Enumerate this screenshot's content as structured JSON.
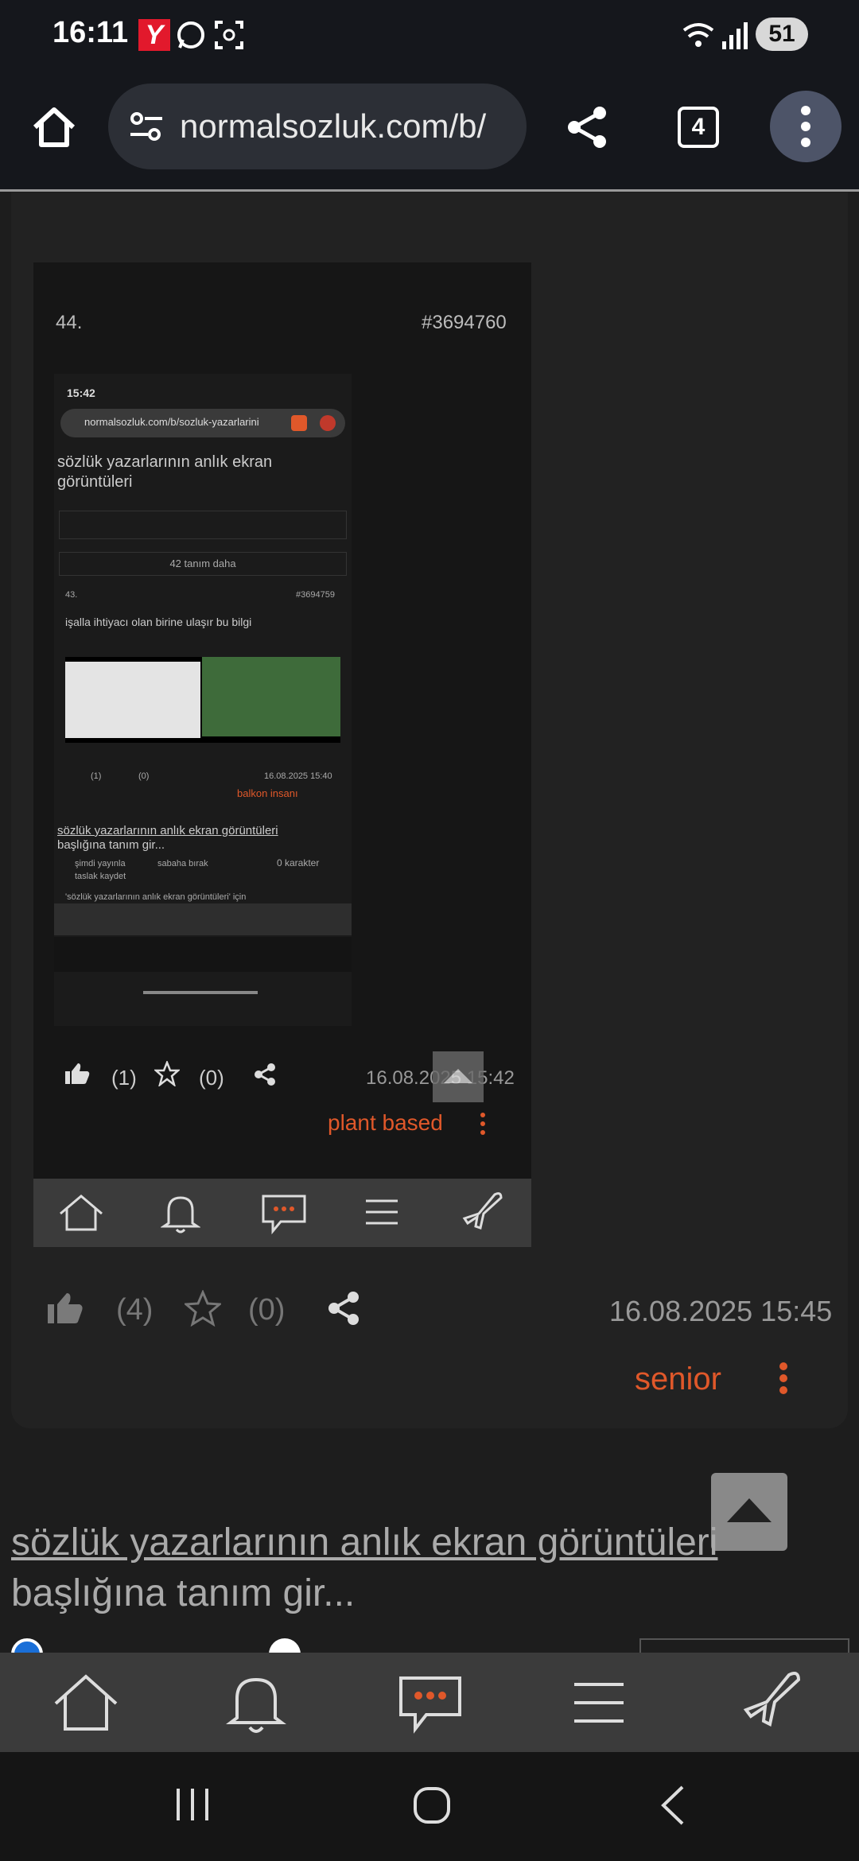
{
  "status_bar": {
    "time": "16:11",
    "battery": "51"
  },
  "browser": {
    "url": "normalsozluk.com/b/",
    "tab_count": "4"
  },
  "embedded": {
    "entry_number": "44.",
    "entry_id": "#3694760",
    "inner": {
      "time": "15:42",
      "url": "normalsozluk.com/b/sozluk-yazarlarini",
      "topic_title_line1": "sözlük yazarlarının anlık ekran",
      "topic_title_line2": "görüntüleri",
      "more_entries": "42 tanım daha",
      "entry_number": "43.",
      "entry_id": "#3694759",
      "entry_text": "işalla ihtiyacı olan birine ulaşır bu bilgi",
      "likes": "(1)",
      "favs": "(0)",
      "date": "16.08.2025 15:40",
      "author": "balkon insanı",
      "topic_link": "sözlük yazarlarının anlık ekran görüntüleri",
      "add_entry": "başlığına tanım gir...",
      "opt_publish": "şimdi yayınla",
      "opt_later": "sabaha bırak",
      "opt_draft": "taslak kaydet",
      "char_count": "0 karakter",
      "textarea_text": "'sözlük yazarlarının anlık ekran görüntüleri' için"
    },
    "likes": "(1)",
    "favs": "(0)",
    "date": "16.08.2025 15:42",
    "author": "plant based"
  },
  "entry": {
    "likes": "(4)",
    "favs": "(0)",
    "date": "16.08.2025 15:45",
    "author": "senior"
  },
  "topic": {
    "link_text": "sözlük yazarlarının anlık ekran görüntüleri",
    "add_entry_text": "başlığına tanım gir..."
  },
  "colors": {
    "accent": "#e0582a",
    "background": "#1d1d1d"
  }
}
